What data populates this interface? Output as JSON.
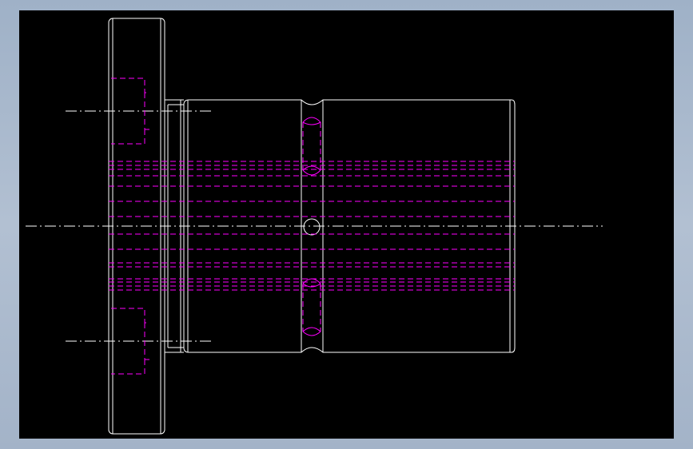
{
  "window": {
    "background": "#a7b7cb"
  },
  "viewport": {
    "background": "#000000"
  },
  "drawing": {
    "view": "side-elevation",
    "colors": {
      "outline": "#ffffff",
      "hidden": "#ff00ff",
      "centerline": "#ffffff"
    },
    "components": [
      "flange",
      "neck",
      "cylindrical-body",
      "center-groove",
      "center-hole",
      "upper-slot",
      "lower-slot",
      "hidden-bores",
      "bolt-holes"
    ]
  }
}
